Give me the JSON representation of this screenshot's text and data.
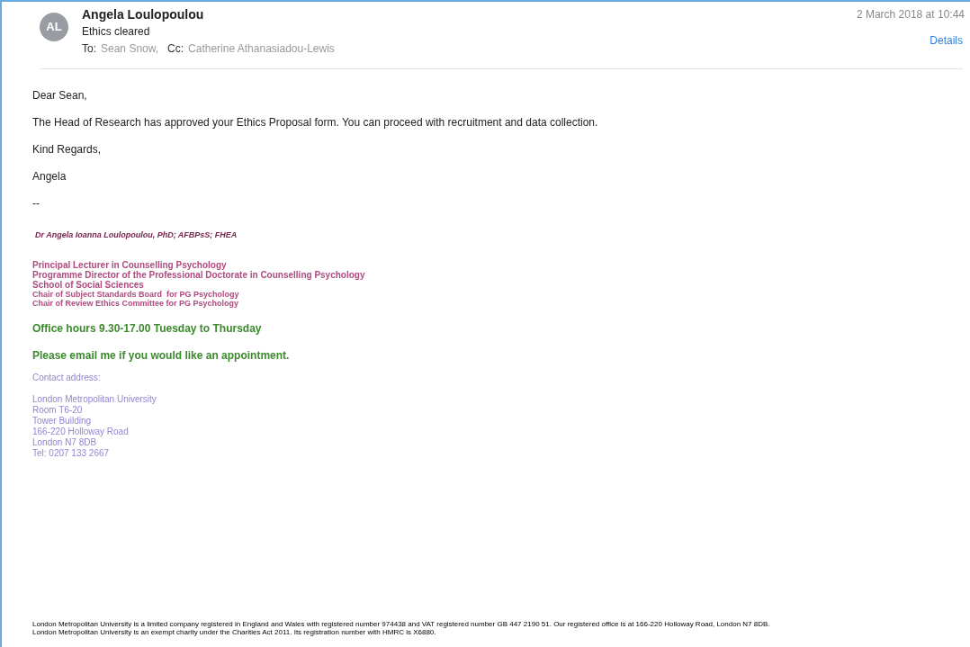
{
  "header": {
    "avatar_initials": "AL",
    "sender": "Angela Loulopoulou",
    "subject": "Ethics cleared",
    "to_label": "To:",
    "to": "Sean Snow,",
    "cc_label": "Cc:",
    "cc": "Catherine Athanasiadou-Lewis",
    "date": "2 March 2018 at 10:44",
    "details_link": "Details"
  },
  "body": [
    "Dear Sean,",
    "The Head of Research has approved your Ethics Proposal form. You can proceed with recruitment and data collection.",
    "Kind Regards,",
    "Angela",
    "--"
  ],
  "signature": [
    {
      "kind": "name",
      "lines": [
        "Dr Angela Ioanna Loulopoulou, PhD; AFBPsS; FHEA"
      ]
    },
    {
      "kind": "title",
      "lines": [
        "Principal Lecturer in Counselling Psychology",
        "Programme Director of the Professional Doctorate in Counselling Psychology",
        "School of Social Sciences"
      ]
    },
    {
      "kind": "title_small",
      "lines": [
        "Chair of Subject Standards Board  for PG Psychology",
        "Chair of Review Ethics Committee for PG Psychology"
      ]
    },
    {
      "kind": "hours",
      "lines": [
        "Office hours 9.30-17.00 Tuesday to Thursday"
      ]
    },
    {
      "kind": "note",
      "lines": [
        "Please email me if you would like an appointment."
      ]
    },
    {
      "kind": "contact",
      "lines": [
        "Contact address:"
      ]
    },
    {
      "kind": "contact",
      "lines": [
        "London Metropolitan University",
        "Room T6-20",
        "Tower Building",
        "166-220 Holloway Road",
        "London N7 8DB",
        "Tel: 0207 133 2667"
      ]
    }
  ],
  "footer": [
    "London Metropolitan University is a limited company registered in England and Wales with registered number 974438 and VAT registered number GB 447 2190 51. Our registered office is at 166-220 Holloway Road, London N7 8DB.",
    "London Metropolitan University is an exempt charity under the Charities Act 2011. Its registration number with HMRC is X6880."
  ]
}
